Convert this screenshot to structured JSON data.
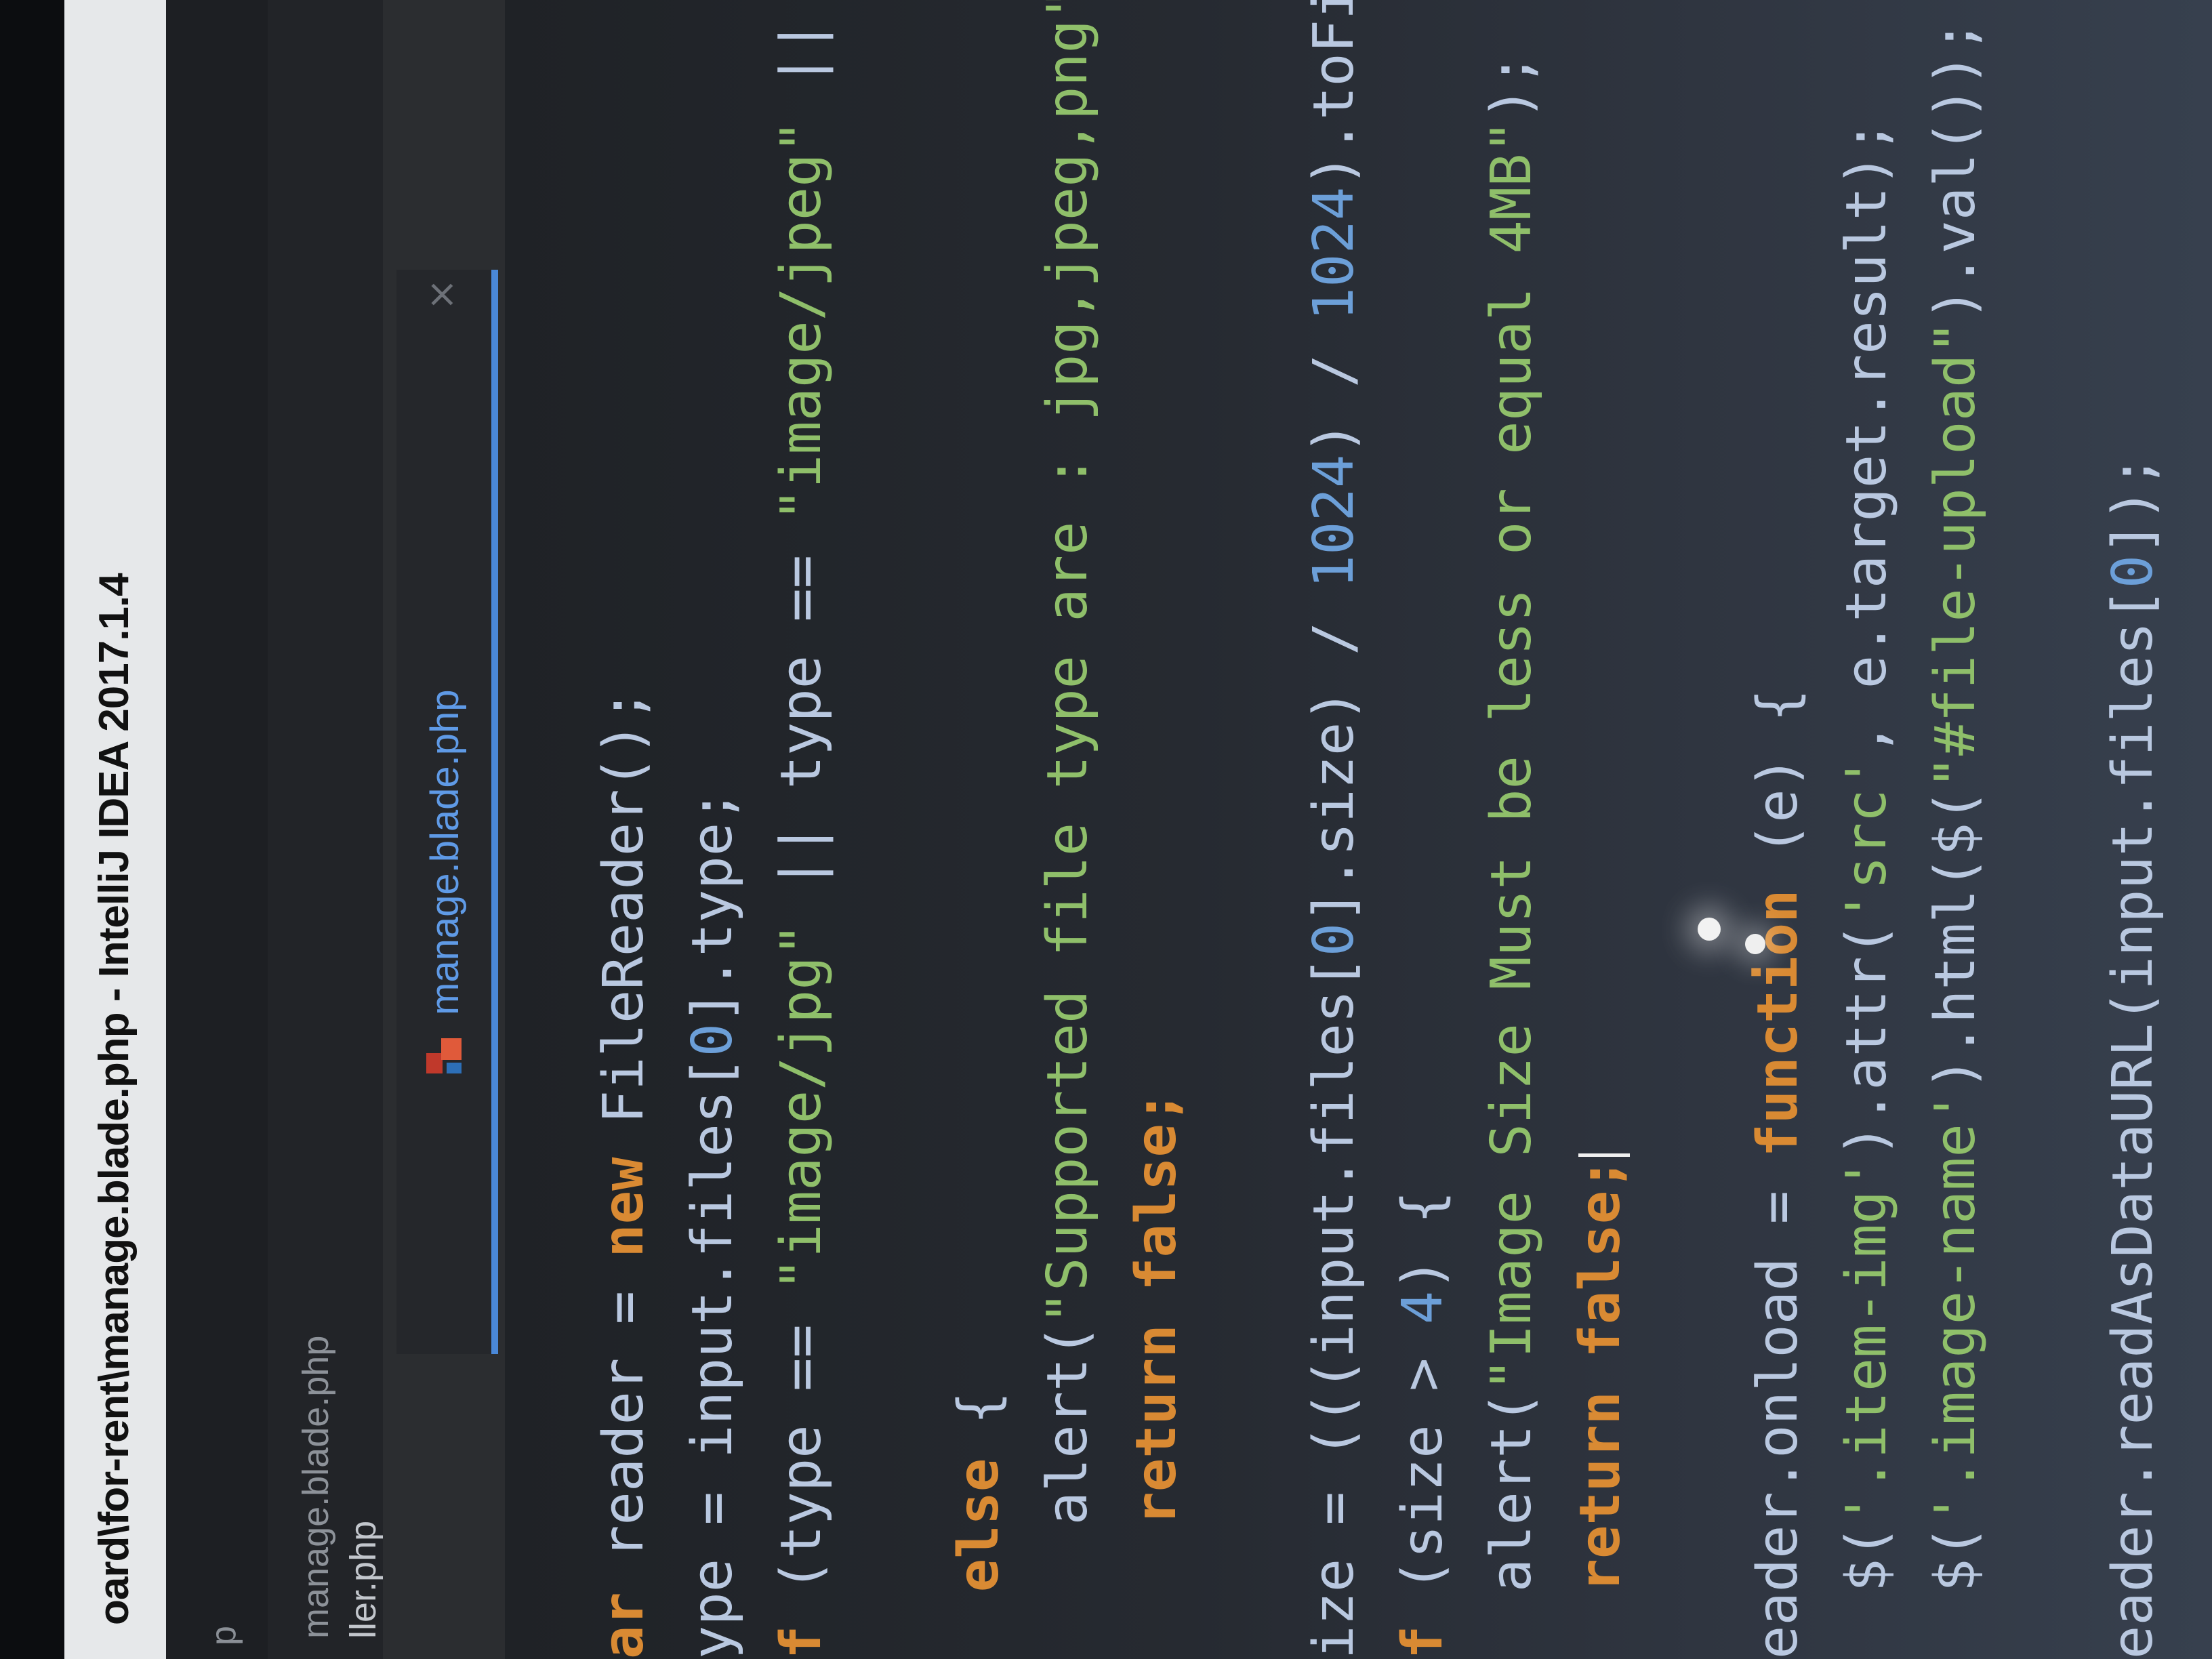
{
  "window": {
    "title": "oard\\for-rent\\manage.blade.php - IntelliJ IDEA 2017.1.4"
  },
  "project_panel": {
    "label": "p"
  },
  "file_list": {
    "items": [
      "manage.blade.php",
      "ller.php"
    ]
  },
  "editor": {
    "active_tab": {
      "label": "manage.blade.php",
      "icon": "php-file-icon",
      "close": "×"
    }
  },
  "colors": {
    "keyword": "#d98a33",
    "string": "#8fbf6a",
    "number": "#6c9fd8",
    "tab_accent": "#4a88d8",
    "text": "#b9c8e0"
  },
  "code": {
    "l1": {
      "a": "ar",
      "b": " reader = ",
      "c": "new",
      "d": " FileReader();"
    },
    "l2": {
      "a": "ype = input.files[",
      "b": "0",
      "c": "].type;"
    },
    "l3": {
      "a": "f",
      "b": " (type == ",
      "c": "\"image/jpg\"",
      "d": " || type == ",
      "e": "\"image/jpeg\"",
      "f": " || t"
    },
    "l4": {
      "a": "  "
    },
    "l5": {
      "a": "  ",
      "b": "else",
      "c": " {"
    },
    "l6": {
      "a": "    alert(",
      "b": "\"Supported file type are : jpg,jpeg,png\"",
      "c": ");"
    },
    "l7": {
      "a": "    ",
      "b": "return",
      "c": " ",
      "d": "false",
      "e": ";"
    },
    "l8": {
      "a": ""
    },
    "l9": {
      "a": "ize = (((input.files[",
      "b": "0",
      "c": "].size) / ",
      "d": "1024",
      "e": ") / ",
      "f": "1024",
      "g": ").toFix"
    },
    "l10": {
      "a": "f",
      "b": " (size > ",
      "c": "4",
      "d": ") {"
    },
    "l11": {
      "a": "  alert(",
      "b": "\"Image Size Must be less or equal 4MB\"",
      "c": ");"
    },
    "l12": {
      "a": "  ",
      "b": "return",
      "c": " ",
      "d": "false",
      "e": ";"
    },
    "l13": {
      "a": ""
    },
    "l14": {
      "a": "eader.onload = ",
      "b": "function",
      "c": " (e) {"
    },
    "l15": {
      "a": "  $(",
      "b": "'.item-img'",
      "c": ").attr(",
      "d": "'src'",
      "e": ", e.target.result);"
    },
    "l16": {
      "a": "  $(",
      "b": "'.image-name'",
      "c": ").html($(",
      "d": "\"#file-upload\"",
      "e": ").val());"
    },
    "l17": {
      "a": ""
    },
    "l18": {
      "a": "eader.readAsDataURL(input.files[",
      "b": "0",
      "c": "]);"
    }
  }
}
